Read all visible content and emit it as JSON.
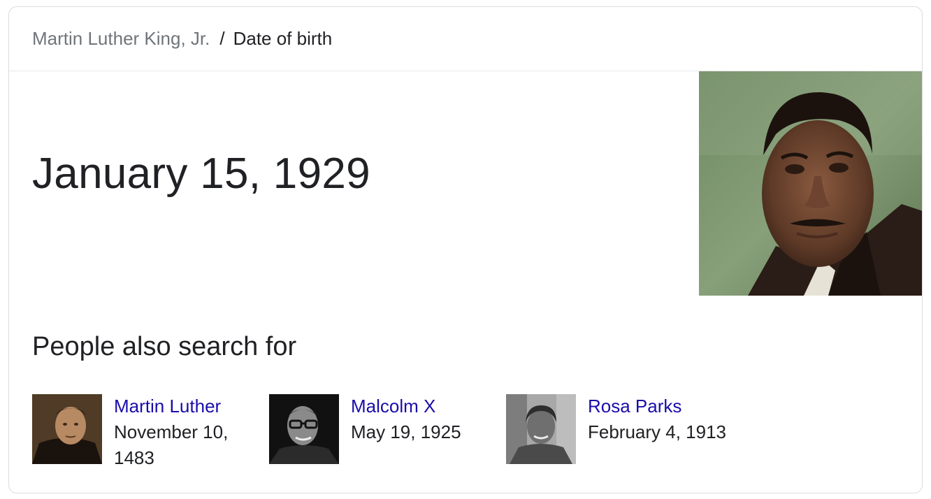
{
  "breadcrumb": {
    "parent": "Martin Luther King, Jr.",
    "separator": "/",
    "current": "Date of birth"
  },
  "answer": {
    "value": "January 15, 1929"
  },
  "hero_image": {
    "subject": "Martin Luther King, Jr."
  },
  "related": {
    "title": "People also search for",
    "people": [
      {
        "name": "Martin Luther",
        "date": "November 10, 1483"
      },
      {
        "name": "Malcolm X",
        "date": "May 19, 1925"
      },
      {
        "name": "Rosa Parks",
        "date": "February 4, 1913"
      }
    ]
  },
  "colors": {
    "link": "#1a0dab",
    "text": "#202124",
    "muted": "#70757a",
    "border": "#dadce0"
  }
}
